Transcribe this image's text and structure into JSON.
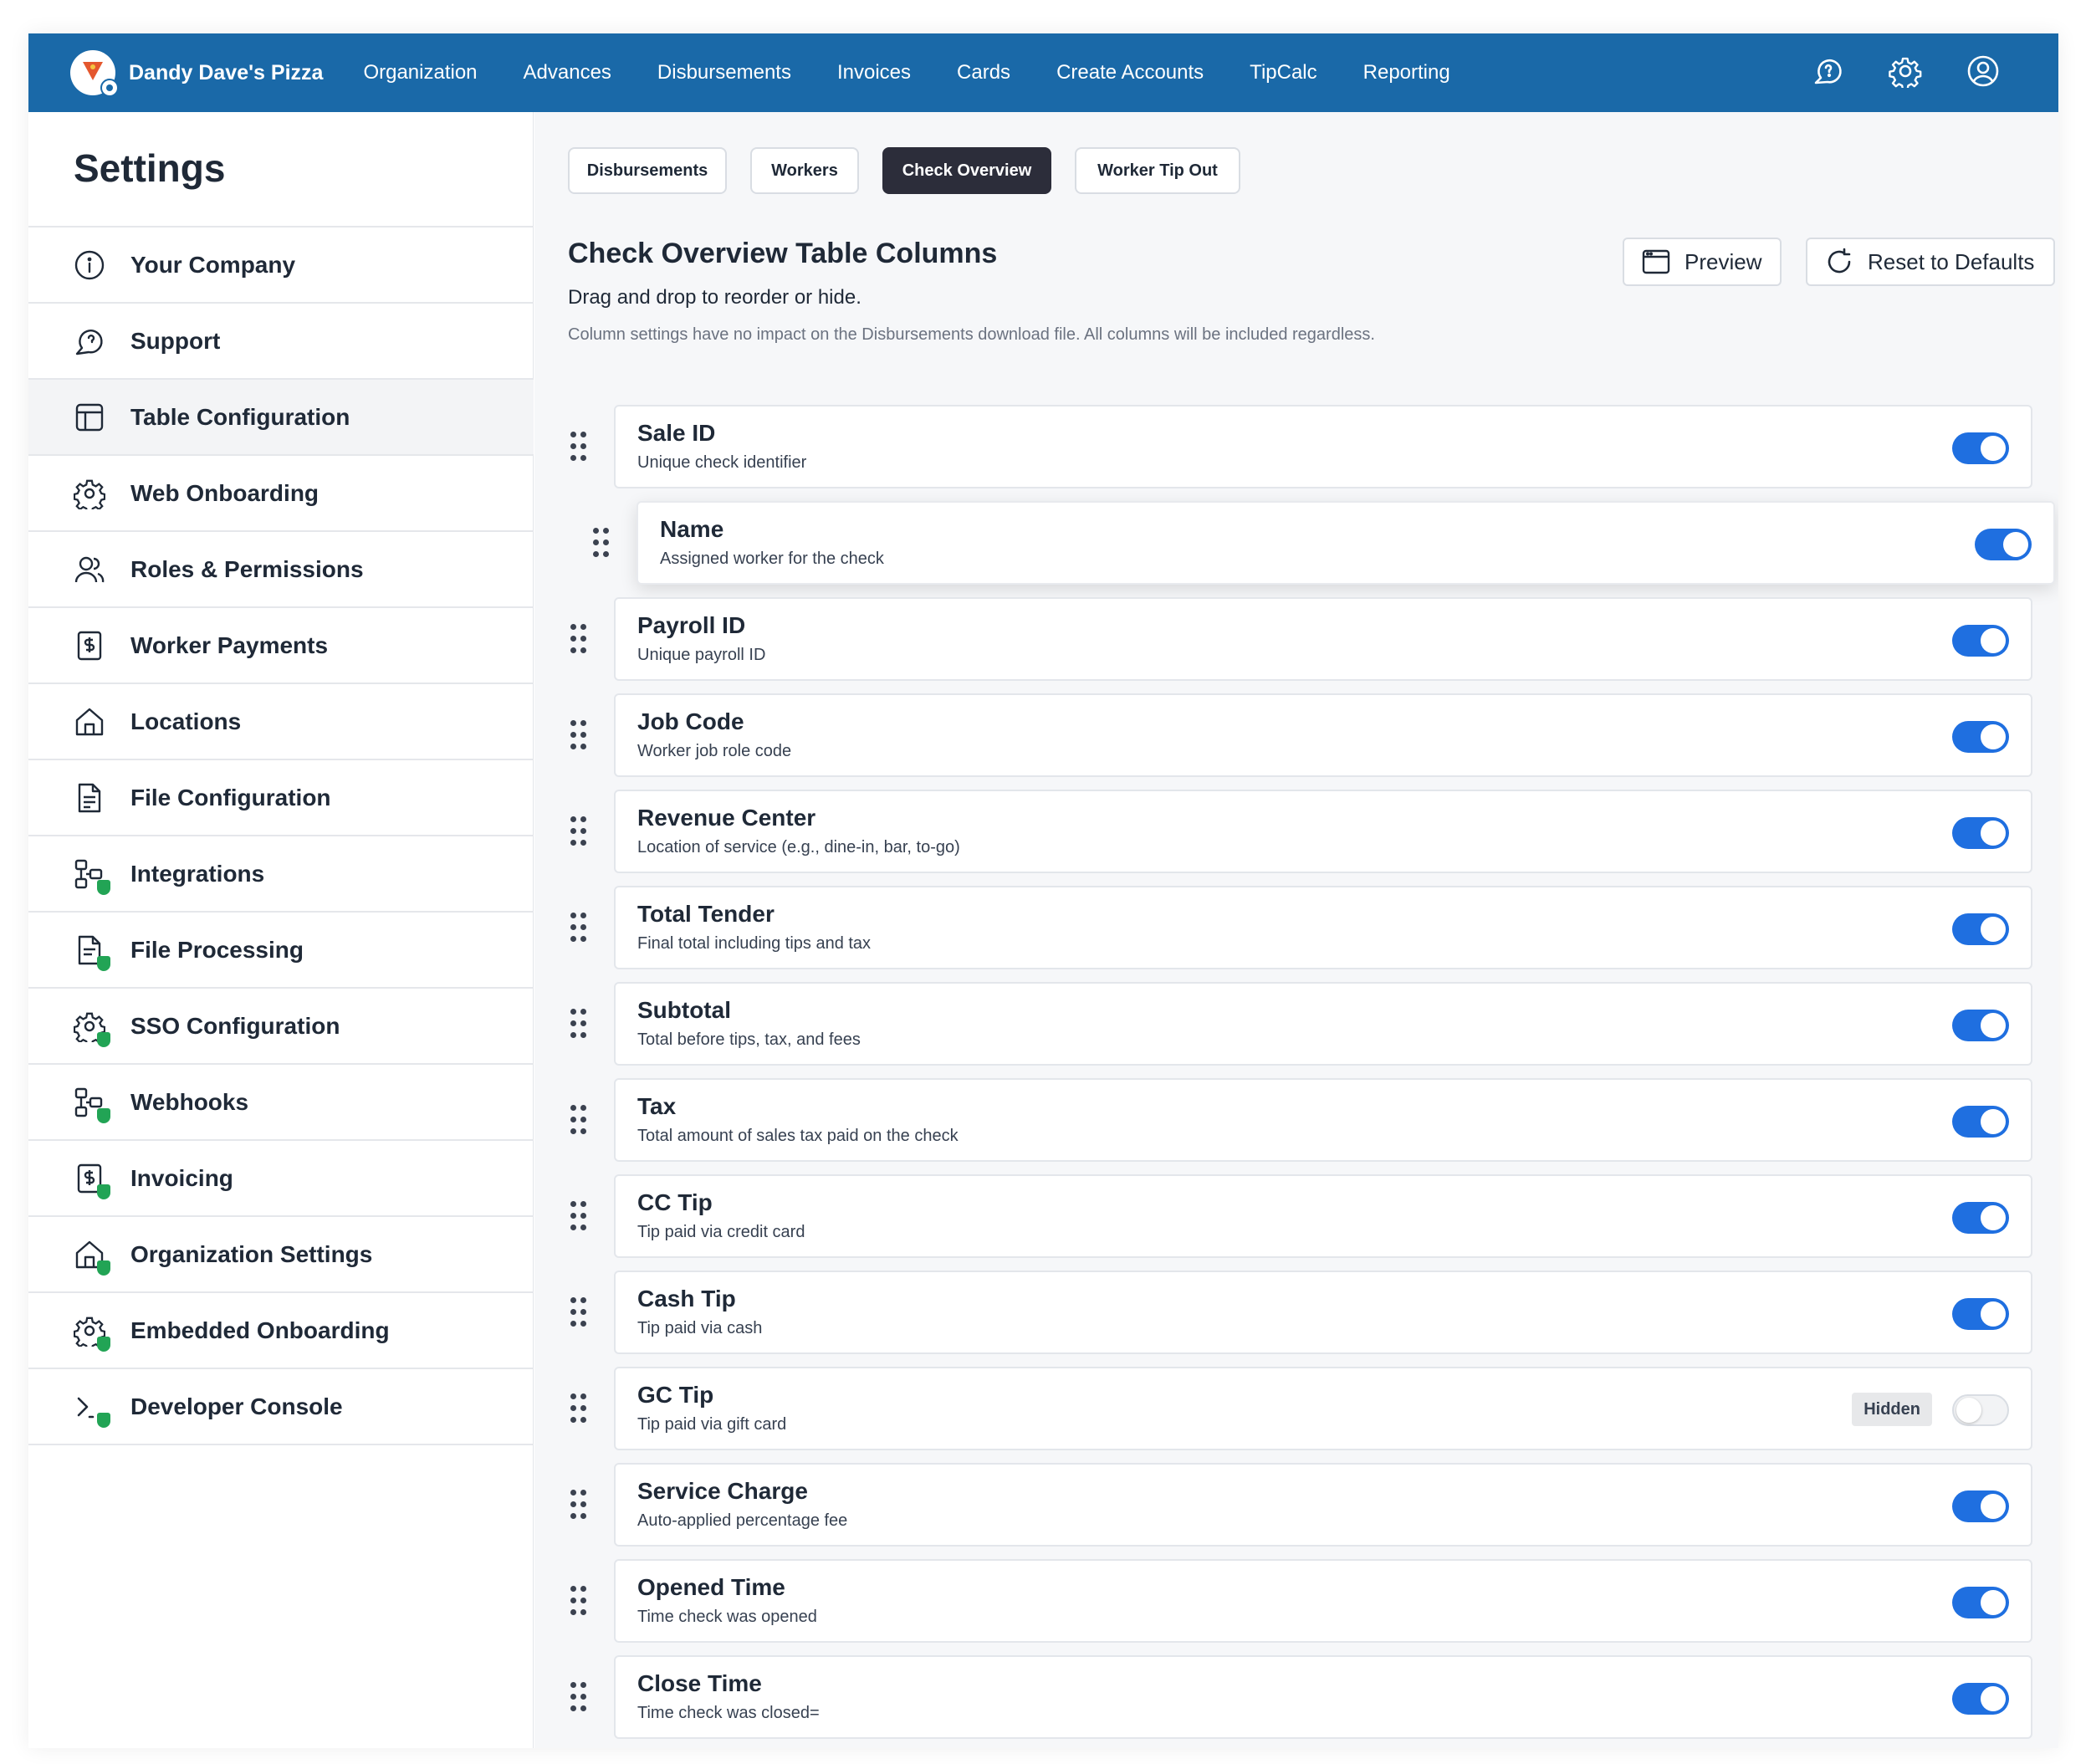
{
  "topnav": {
    "brand_name": "Dandy Dave's Pizza",
    "links": [
      "Organization",
      "Advances",
      "Disbursements",
      "Invoices",
      "Cards",
      "Create Accounts",
      "TipCalc",
      "Reporting"
    ],
    "icons": [
      "support-icon",
      "gear-icon",
      "user-icon"
    ],
    "bg_color": "#1a69a8"
  },
  "sidebar": {
    "title": "Settings",
    "items": [
      {
        "label": "Your Company",
        "icon": "info-icon",
        "admin": false
      },
      {
        "label": "Support",
        "icon": "support-icon",
        "admin": false
      },
      {
        "label": "Table Configuration",
        "icon": "table-icon",
        "admin": false,
        "active": true
      },
      {
        "label": "Web Onboarding",
        "icon": "gear-icon",
        "admin": false
      },
      {
        "label": "Roles & Permissions",
        "icon": "users-icon",
        "admin": false
      },
      {
        "label": "Worker Payments",
        "icon": "dollar-receipt-icon",
        "admin": false
      },
      {
        "label": "Locations",
        "icon": "home-icon",
        "admin": false
      },
      {
        "label": "File Configuration",
        "icon": "document-icon",
        "admin": false
      },
      {
        "label": "Integrations",
        "icon": "integration-icon",
        "admin": true
      },
      {
        "label": "File Processing",
        "icon": "document-icon",
        "admin": true
      },
      {
        "label": "SSO Configuration",
        "icon": "gear-icon",
        "admin": true
      },
      {
        "label": "Webhooks",
        "icon": "integration-icon",
        "admin": true
      },
      {
        "label": "Invoicing",
        "icon": "dollar-receipt-icon",
        "admin": true
      },
      {
        "label": "Organization Settings",
        "icon": "home-icon",
        "admin": true
      },
      {
        "label": "Embedded Onboarding",
        "icon": "gear-icon",
        "admin": true
      },
      {
        "label": "Developer Console",
        "icon": "terminal-icon",
        "admin": true
      }
    ]
  },
  "tabs": [
    {
      "label": "Disbursements",
      "active": false
    },
    {
      "label": "Workers",
      "active": false
    },
    {
      "label": "Check Overview",
      "active": true
    },
    {
      "label": "Worker Tip Out",
      "active": false
    }
  ],
  "section": {
    "title": "Check Overview Table Columns",
    "subtitle": "Drag and drop to reorder or hide.",
    "note": "Column settings have no impact on the Disbursements download file. All columns will be included regardless.",
    "preview_label": "Preview",
    "reset_label": "Reset to Defaults"
  },
  "columns": [
    {
      "name": "Sale ID",
      "desc": "Unique check identifier",
      "enabled": true
    },
    {
      "name": "Name",
      "desc": "Assigned worker for the check",
      "enabled": true,
      "dragging": true
    },
    {
      "name": "Payroll ID",
      "desc": "Unique payroll ID",
      "enabled": true
    },
    {
      "name": "Job Code",
      "desc": "Worker job role code",
      "enabled": true
    },
    {
      "name": "Revenue Center",
      "desc": "Location of service (e.g., dine-in, bar, to-go)",
      "enabled": true
    },
    {
      "name": "Total Tender",
      "desc": "Final total including tips and tax",
      "enabled": true
    },
    {
      "name": "Subtotal",
      "desc": "Total before tips, tax, and fees",
      "enabled": true
    },
    {
      "name": "Tax",
      "desc": "Total amount of sales tax paid on the check",
      "enabled": true
    },
    {
      "name": "CC Tip",
      "desc": "Tip paid via credit card",
      "enabled": true
    },
    {
      "name": "Cash Tip",
      "desc": "Tip paid via cash",
      "enabled": true
    },
    {
      "name": "GC Tip",
      "desc": "Tip paid via gift card",
      "enabled": false,
      "badge": "Hidden"
    },
    {
      "name": "Service Charge",
      "desc": "Auto-applied percentage fee",
      "enabled": true
    },
    {
      "name": "Opened Time",
      "desc": "Time check was opened",
      "enabled": true
    },
    {
      "name": "Close Time",
      "desc": "Time check was closed=",
      "enabled": true
    }
  ],
  "colors": {
    "toggle_on": "#1f6fe0",
    "active_tab": "#2c2d3a",
    "admin_shield": "#22a455"
  }
}
